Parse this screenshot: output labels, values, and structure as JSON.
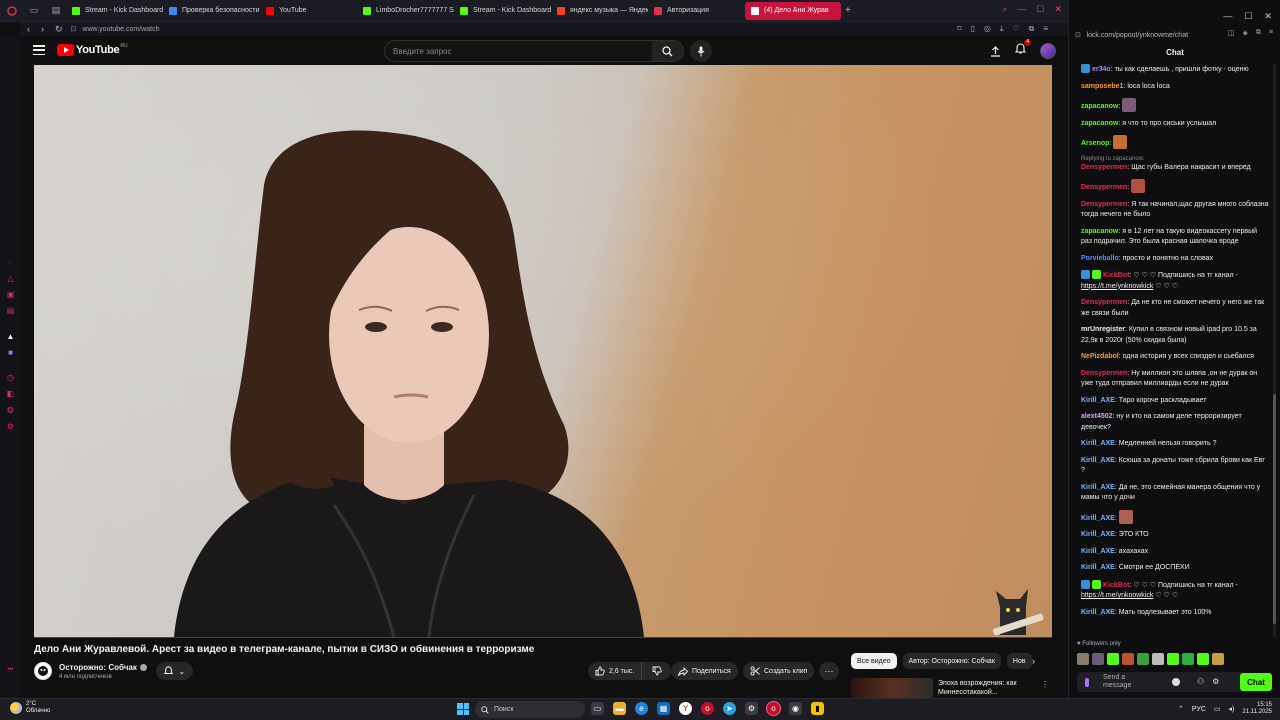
{
  "browser": {
    "tabs": [
      {
        "label": "Stream - Kick Dashboard",
        "color": "#53fc18"
      },
      {
        "label": "Проверка безопасности",
        "color": "#4285f4"
      },
      {
        "label": "YouTube",
        "color": "#ff0000"
      },
      {
        "label": "LimboDrocher7777777 S",
        "color": "#53fc18"
      },
      {
        "label": "Stream - Kick Dashboard",
        "color": "#53fc18"
      },
      {
        "label": "яндекс музыка — Яндекс",
        "color": "#fc3f1d"
      },
      {
        "label": "Авторизация",
        "color": "#e0304c"
      },
      {
        "label": "(4) Дело Ани Журав",
        "color": "#ffffff"
      }
    ],
    "url": "www.youtube.com/watch"
  },
  "youtube": {
    "logo_text": "YouTube",
    "logo_region": "RU",
    "search_placeholder": "Введите запрос",
    "notification_count": "4",
    "video_title": "Дело Ани Журавлевой. Арест за видео в телеграм-канале, пытки в СИЗО и обвинения в терроризме",
    "channel_name": "Осторожно: Собчак",
    "channel_subs": "4 млн подписчиков",
    "likes": "2,6 тыс.",
    "share_label": "Поделиться",
    "clip_label": "Создать клип",
    "chips": [
      "Все видео",
      "Автор: Осторожно: Собчак",
      "Нов"
    ],
    "rec_title": "Эпоха возрождения: как Миннесотакакой..."
  },
  "chat": {
    "url": "kick.com/popout/ynknowme/chat",
    "title": "Chat",
    "messages": [
      {
        "user": "er34o",
        "color": "#ad7fff",
        "text": "ты как сделаешь , пришли фотку - оценю",
        "badge": "#3a90d8"
      },
      {
        "user": "samposebe1",
        "color": "#ff9a36",
        "text": "loca loca loca"
      },
      {
        "user": "zapacanow",
        "color": "#53fc18",
        "text": "",
        "emote": "#7a5c7a"
      },
      {
        "user": "zapacanow",
        "color": "#53fc18",
        "text": "я что то про сиськи услышал"
      },
      {
        "user": "Arsenop",
        "color": "#53fc18",
        "text": "",
        "emote": "#c07030"
      },
      {
        "reply": "Replying to zapacanow:",
        "user": "Densypermen",
        "color": "#e0304c",
        "text": "Щас губы Валера накрасит и вперед"
      },
      {
        "user": "Densypermen",
        "color": "#e0304c",
        "text": "",
        "emote": "#b05040"
      },
      {
        "user": "Densypermen",
        "color": "#e0304c",
        "text": "Я так начинал,щас другая много соблазна тогда нечего не было"
      },
      {
        "user": "zapacanow",
        "color": "#53fc18",
        "text": "я в 12 лет на такую видеокассету первый раз подрачил. Это была красная шапочка вроде"
      },
      {
        "user": "Porvieballo",
        "color": "#5a8cff",
        "text": "просто и понятно на словах"
      },
      {
        "user": "KickBot",
        "color": "#e0304c",
        "text": "♡ ♡ ♡ Подпишись на тг канал - ",
        "link": "https://t.me/ynknowkick",
        "tail": " ♡ ♡ ♡",
        "badge": "#3a90d8",
        "badge2": "#53fc18"
      },
      {
        "user": "Densypermen",
        "color": "#e0304c",
        "text": "Да не кто не сможет нечего у него же так же связи были"
      },
      {
        "user": "mrUnregister",
        "color": "#efeff1",
        "text": "Купил в связном новый ipad pro 10.5 за 22,9к в 2020г (50% скидка была)"
      },
      {
        "user": "NePizdabol",
        "color": "#ff9a36",
        "text": "одна история у всех спиздел и сьебался"
      },
      {
        "user": "Densypermen",
        "color": "#e0304c",
        "text": "Ну миллион это шляпа ,он не дурак он уже туда отправил миллиарды если не дурак"
      },
      {
        "user": "Kirill_AXE",
        "color": "#7db2ff",
        "text": "Таро короче раскладывает"
      },
      {
        "user": "alext4502",
        "color": "#d9a3ff",
        "text": "ну и кто на самом деле терроризирует девочек?"
      },
      {
        "user": "Kirill_AXE",
        "color": "#7db2ff",
        "text": "Медленней нельзя говорить ?"
      },
      {
        "user": "Kirill_AXE",
        "color": "#7db2ff",
        "text": "Ксюша за донаты тоже сбрила брови как Евг ?"
      },
      {
        "user": "Kirill_AXE",
        "color": "#7db2ff",
        "text": "Да не, это семейная манера общения что у мамы что у дочи"
      },
      {
        "user": "Kirill_AXE",
        "color": "#7db2ff",
        "text": "",
        "emote": "#b06050"
      },
      {
        "user": "Kirill_AXE",
        "color": "#7db2ff",
        "text": "ЭТО КТО"
      },
      {
        "user": "Kirill_AXE",
        "color": "#7db2ff",
        "text": "ахахахах"
      },
      {
        "user": "Kirill_AXE",
        "color": "#7db2ff",
        "text": "Смотри ее ДОСПЕХИ"
      },
      {
        "user": "KickBot",
        "color": "#e0304c",
        "text": "♡ ♡ ♡ Подпишись на тг канал - ",
        "link": "https://t.me/ynknowkick",
        "tail": " ♡ ♡ ♡",
        "badge": "#3a90d8",
        "badge2": "#53fc18"
      },
      {
        "user": "Kirill_AXE",
        "color": "#7db2ff",
        "text": "Мать подлезывает это 100%"
      }
    ],
    "followers_only": "Followers only",
    "input_placeholder": "Send a message",
    "send_label": "Chat"
  },
  "taskbar": {
    "temperature": "2°C",
    "weather": "Облачно",
    "search_label": "Поиск",
    "lang": "РУС",
    "time": "15:15",
    "date": "21.11.2025"
  }
}
